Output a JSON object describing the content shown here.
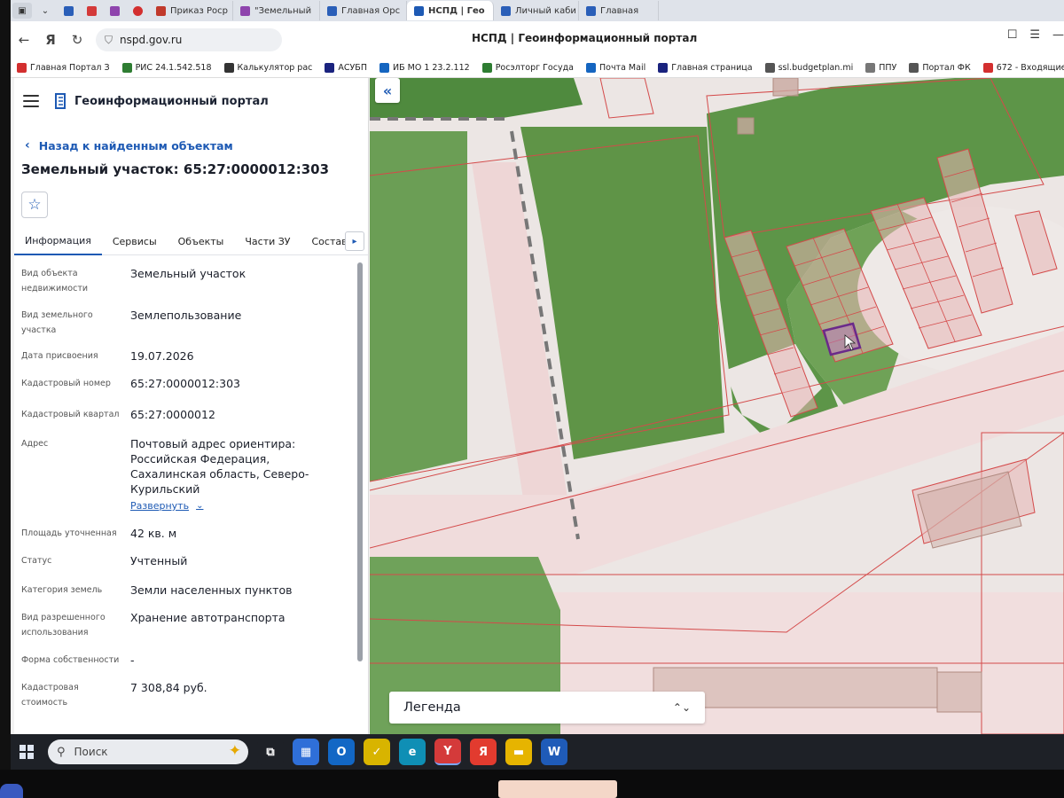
{
  "browser": {
    "tabs": [
      {
        "label": "Приказ Роср",
        "color": "#c0392b"
      },
      {
        "label": "\"Земельный",
        "color": "#8e44ad"
      },
      {
        "label": "Главная Орс",
        "color": "#2b5fb8"
      },
      {
        "label": "НСПД | Гео",
        "color": "#1e5ab4",
        "active": true
      },
      {
        "label": "Личный каби",
        "color": "#2b5fb8"
      },
      {
        "label": "Главная",
        "color": "#2b5fb8"
      }
    ],
    "page_title": "НСПД | Геоинформационный портал",
    "url": "nspd.gov.ru",
    "bookmarks": [
      {
        "label": "Главная Портал З",
        "color": "#d32f2f"
      },
      {
        "label": "РИС 24.1.542.518",
        "color": "#2e7d32"
      },
      {
        "label": "Калькулятор рас",
        "color": "#333333"
      },
      {
        "label": "АСУБП",
        "color": "#1a237e"
      },
      {
        "label": "ИБ МО 1 23.2.112",
        "color": "#1565c0"
      },
      {
        "label": "Росэлторг Госуда",
        "color": "#2e7d32"
      },
      {
        "label": "Почта Mail",
        "color": "#1565c0"
      },
      {
        "label": "Главная страница",
        "color": "#1a237e"
      },
      {
        "label": "ssl.budgetplan.mi",
        "color": "#555555"
      },
      {
        "label": "ППУ",
        "color": "#777777"
      },
      {
        "label": "Портал ФК",
        "color": "#555555"
      },
      {
        "label": "672 - Входящие",
        "color": "#d32f2f"
      }
    ]
  },
  "portal": {
    "name": "Геоинформационный портал",
    "back_link": "Назад к найденным объектам",
    "object_title": "Земельный участок: 65:27:0000012:303",
    "tabs": [
      "Информация",
      "Сервисы",
      "Объекты",
      "Части ЗУ",
      "Состав"
    ],
    "fields": [
      {
        "label": "Вид объекта недвижимости",
        "value": "Земельный участок"
      },
      {
        "label": "Вид земельного участка",
        "value": "Землепользование"
      },
      {
        "label": "Дата присвоения",
        "value": "19.07.2026"
      },
      {
        "label": "Кадастровый номер",
        "value": "65:27:0000012:303"
      },
      {
        "label": "Кадастровый квартал",
        "value": "65:27:0000012"
      },
      {
        "label": "Адрес",
        "value": "Почтовый адрес ориентира: Российская Федерация, Сахалинская область, Северо-Курильский"
      },
      {
        "label": "Площадь уточненная",
        "value": "42 кв. м"
      },
      {
        "label": "Статус",
        "value": "Учтенный"
      },
      {
        "label": "Категория земель",
        "value": "Земли населенных пунктов"
      },
      {
        "label": "Вид разрешенного использования",
        "value": "Хранение автотранспорта"
      },
      {
        "label": "Форма собственности",
        "value": "-"
      },
      {
        "label": "Кадастровая стоимость",
        "value": "7 308,84 руб."
      }
    ],
    "expand_label": "Развернуть"
  },
  "map": {
    "legend_label": "Легенда",
    "colors": {
      "parcel_border": "#d44a4a",
      "parcel_fill": "#e8b9b9",
      "green": "#5a9447",
      "selected": "#6a2a8a"
    }
  },
  "taskbar": {
    "search_placeholder": "Поиск",
    "apps": [
      {
        "name": "task-view-icon",
        "glyph": "⧉",
        "color": "#1e2127"
      },
      {
        "name": "store-icon",
        "glyph": "▦",
        "color": "#2f6fd8"
      },
      {
        "name": "outlook-icon",
        "glyph": "O",
        "color": "#1267c5"
      },
      {
        "name": "tasks-icon",
        "glyph": "✓",
        "color": "#d8b400"
      },
      {
        "name": "edge-icon",
        "glyph": "e",
        "color": "#0f8fb5"
      },
      {
        "name": "yandex-browser-icon",
        "glyph": "Y",
        "color": "#d43a3a"
      },
      {
        "name": "yandex-icon",
        "glyph": "Я",
        "color": "#e23b2f"
      },
      {
        "name": "explorer-icon",
        "glyph": "▬",
        "color": "#e6b400"
      },
      {
        "name": "word-icon",
        "glyph": "W",
        "color": "#1f5bb8"
      }
    ]
  }
}
